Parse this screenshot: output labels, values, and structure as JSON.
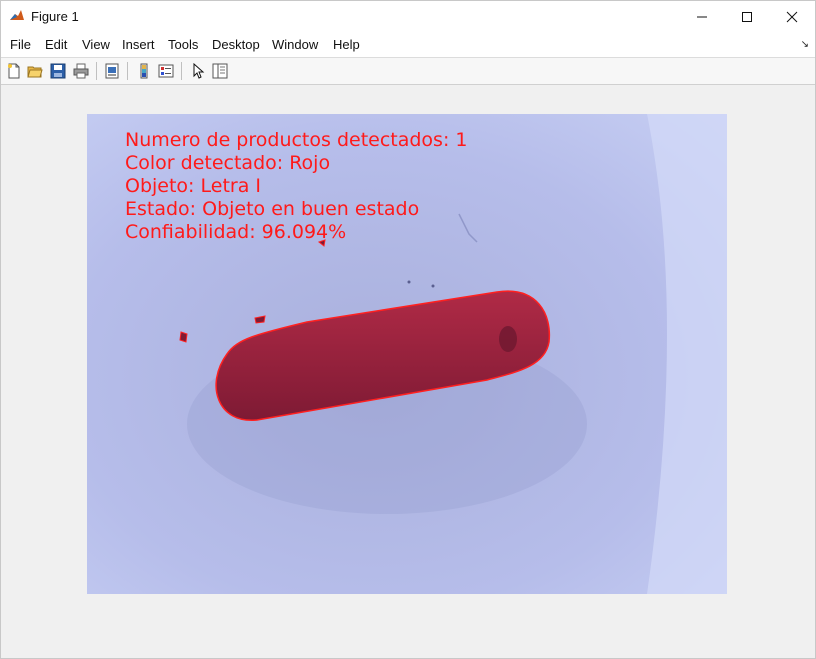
{
  "window": {
    "title": "Figure 1",
    "controls": {
      "minimize": "—",
      "maximize": "☐",
      "close": "✕"
    }
  },
  "menu": {
    "items": [
      "File",
      "Edit",
      "View",
      "Insert",
      "Tools",
      "Desktop",
      "Window",
      "Help"
    ],
    "overflow": "↘"
  },
  "toolbar": {
    "buttons": [
      "new-figure-icon",
      "open-file-icon",
      "save-icon",
      "print-icon",
      "print-preview-icon",
      "colorbar-icon",
      "legend-icon",
      "edit-plot-arrow-icon",
      "property-inspector-icon"
    ]
  },
  "figure": {
    "annotations": {
      "line1": "Numero de productos detectados: 1",
      "line2": "Color detectado: Rojo",
      "line3": "Objeto: Letra I",
      "line4": "Estado: Objeto en buen estado",
      "line5": "Confiabilidad: 96.094%"
    },
    "annotation_color": "#ff1a1a",
    "object_color": "#a0203a",
    "background_color": "#bcc4ee"
  }
}
